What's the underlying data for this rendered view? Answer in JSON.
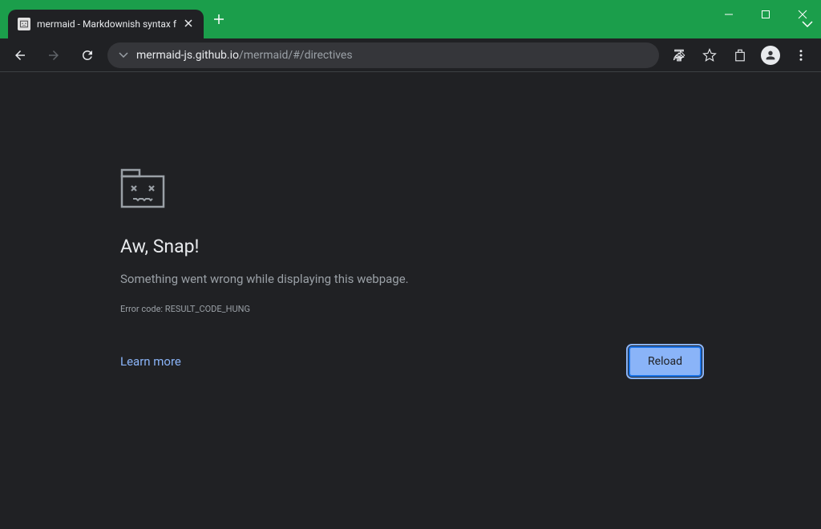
{
  "tab": {
    "title": "mermaid - Markdownish syntax f"
  },
  "address": {
    "domain": "mermaid-js.github.io",
    "path": "/mermaid/#/directives"
  },
  "error": {
    "title": "Aw, Snap!",
    "message": "Something went wrong while displaying this webpage.",
    "code": "Error code: RESULT_CODE_HUNG",
    "learn_more": "Learn more",
    "reload": "Reload"
  }
}
